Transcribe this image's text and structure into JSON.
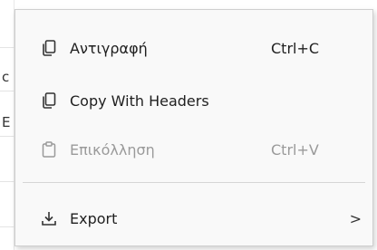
{
  "background": {
    "partial_cells": [
      "c",
      "E"
    ]
  },
  "menu": {
    "items": [
      {
        "label": "Αντιγραφή",
        "shortcut": "Ctrl+C",
        "icon": "copy-icon",
        "enabled": true
      },
      {
        "label": "Copy With Headers",
        "shortcut": "",
        "icon": "copy-icon",
        "enabled": true
      },
      {
        "label": "Επικόλληση",
        "shortcut": "Ctrl+V",
        "icon": "paste-icon",
        "enabled": false
      }
    ],
    "export": {
      "label": "Export",
      "icon": "download-icon",
      "submenu_indicator": ">"
    }
  },
  "colors": {
    "menu_bg": "#f9f9f9",
    "text": "#1f1f1f",
    "disabled_text": "#9a9a9a",
    "border": "#cfcfcf"
  }
}
